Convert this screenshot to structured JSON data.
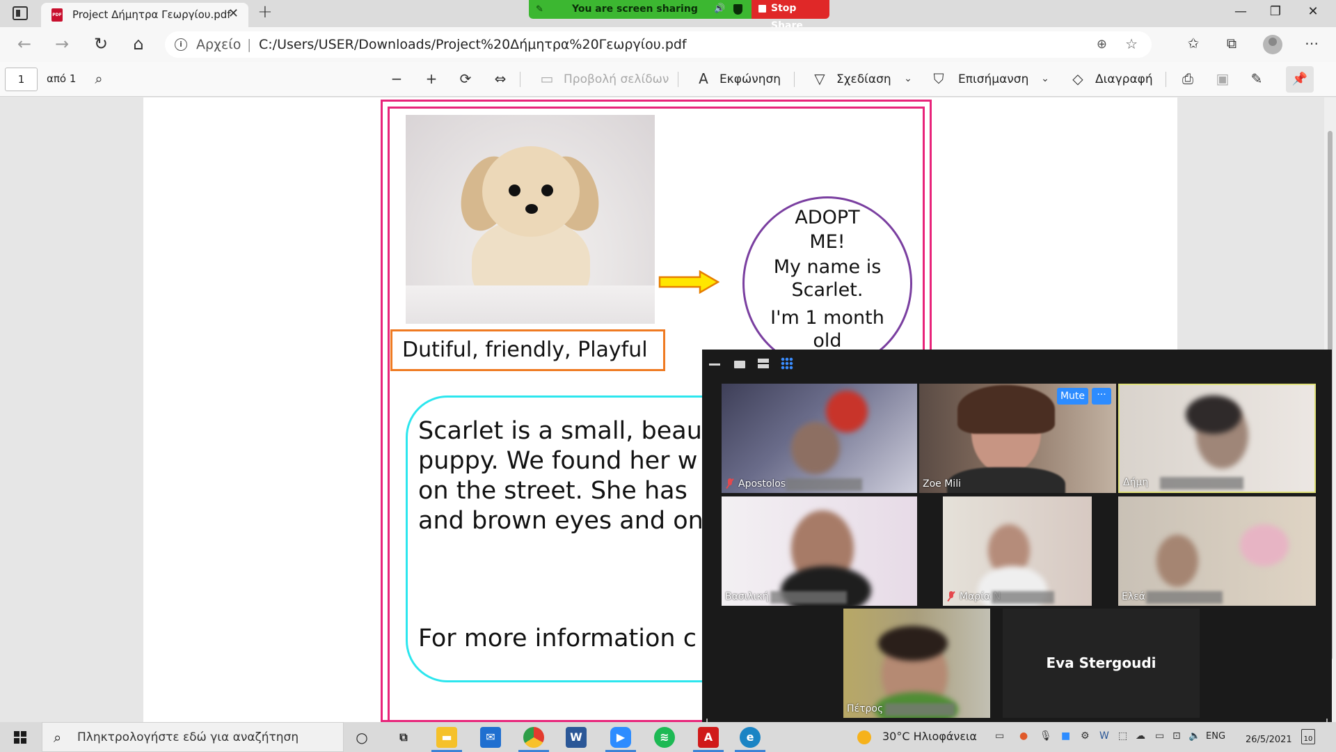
{
  "browser": {
    "tab_title": "Project Δήμητρα Γεωργίου.pdf",
    "tab_close": "✕",
    "new_tab": "+",
    "address_label": "Αρχείο",
    "address_sep": "|",
    "url": "C:/Users/USER/Downloads/Project%20Δήμητρα%20Γεωργίου.pdf",
    "window_controls": {
      "minimize": "—",
      "maximize": "❐",
      "close": "✕"
    },
    "icons": [
      "tab-actions-icon",
      "back-icon",
      "forward-icon",
      "refresh-icon",
      "home-icon",
      "info-icon",
      "zoom-icon",
      "add-favorite-icon",
      "favorites-icon",
      "collections-icon",
      "profile-avatar",
      "more-icon"
    ]
  },
  "share_banner": {
    "text": "You are screen sharing",
    "stop_label": "Stop Share",
    "colors": {
      "banner": "#3cb731",
      "stop": "#e02828"
    }
  },
  "pdf_toolbar": {
    "page_number": "1",
    "page_of": "από 1",
    "page_view": "Προβολή σελίδων",
    "read_aloud": "Εκφώνηση",
    "draw": "Σχεδίαση",
    "highlight": "Επισήμανση",
    "erase": "Διαγραφή"
  },
  "document": {
    "traits": "Dutiful, friendly, Playful",
    "adopt_lines": [
      "ADOPT",
      "ME!",
      "My name is",
      "Scarlet.",
      "I'm 1 month",
      "old"
    ],
    "description": "Scarlet is a small, beau\npuppy. We found her w\non the street. She has \nand brown eyes and on",
    "more_info": "For more information c",
    "colors": {
      "frame": "#e8247a",
      "traits_border": "#ef7a22",
      "circle": "#7a3fa0",
      "desc_border": "#2ce6ee",
      "arrow": "#ffe600"
    }
  },
  "zoom_gallery": {
    "mute_label": "Mute",
    "more_label": "···",
    "participants": [
      {
        "name": "Apostolos",
        "muted": true
      },
      {
        "name": "Zoe Mili",
        "muted": false
      },
      {
        "name": "Δήμη",
        "muted": false,
        "active_speaker": true
      },
      {
        "name": "Βασιλική",
        "muted": false
      },
      {
        "name": "Μαρία Ν",
        "muted": true
      },
      {
        "name": "Ελεά",
        "muted": false
      },
      {
        "name": "Πέτρος",
        "muted": false
      },
      {
        "name": "Eva Stergoudi",
        "video_off": true
      }
    ]
  },
  "taskbar": {
    "search_placeholder": "Πληκτρολογήστε εδώ για αναζήτηση",
    "weather": "30°C  Ηλιοφάνεια",
    "language": "ENG",
    "date": "26/5/2021",
    "notifications": "10",
    "apps": [
      "cortana-icon",
      "task-view-icon",
      "file-explorer-icon",
      "mail-icon",
      "chrome-icon",
      "word-icon",
      "zoom-app-icon",
      "spotify-icon",
      "acrobat-icon",
      "edge-icon"
    ]
  }
}
